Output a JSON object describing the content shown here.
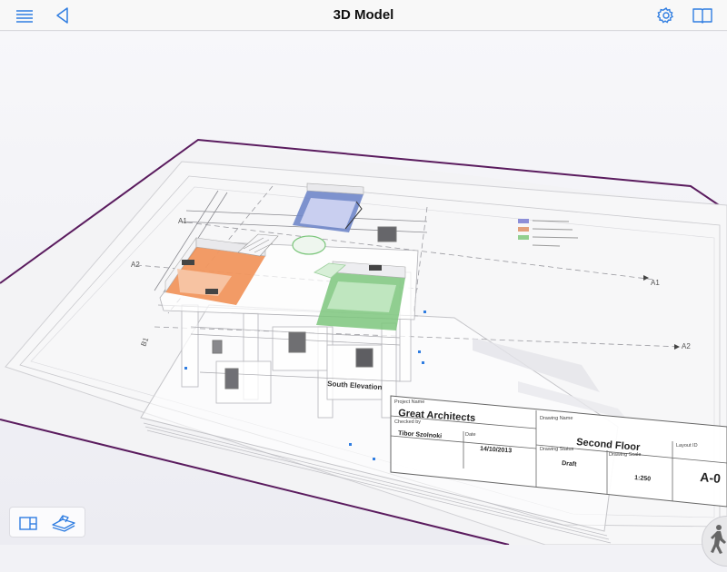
{
  "header": {
    "title": "3D Model",
    "menu_icon": "menu-list-icon",
    "back_icon": "back-triangle-icon",
    "settings_icon": "gear-icon",
    "book_icon": "open-book-icon"
  },
  "model": {
    "elevation_label": "South Elevation",
    "grid_labels": [
      "A1",
      "A2",
      "B1",
      "A1",
      "A2"
    ]
  },
  "title_block": {
    "project_name_label": "Project Name",
    "project_name": "Great Architects",
    "checked_by_label": "Checked by",
    "checked_by": "Tibor Szolnoki",
    "date_label": "Date",
    "date": "14/10/2013",
    "drawing_name_label": "Drawing Name",
    "drawing_name": "Second Floor",
    "drawing_status_label": "Drawing Status",
    "drawing_status": "Draft",
    "drawing_scale_label": "Drawing Scale",
    "drawing_scale": "1:250",
    "layout_id_label": "Layout ID",
    "layout_id": "A-0"
  },
  "bottom_toolbar": {
    "layout_icon": "sheet-view-icon",
    "model_icon": "3d-layers-icon"
  },
  "walk_icon": "walking-person-icon",
  "colors": {
    "accent": "#2f7de1",
    "plane_outline": "#5a1b5e",
    "orange_room": "#f08a4b",
    "green_room": "#7cc67c",
    "blue_room": "#6f86c9"
  }
}
